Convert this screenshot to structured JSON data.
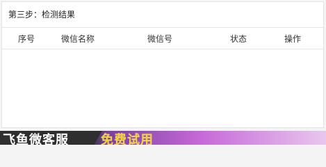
{
  "section": {
    "title": "第三步：检测结果"
  },
  "table": {
    "columns": [
      "序号",
      "微信名称",
      "微信号",
      "状态",
      "操作"
    ],
    "rows": []
  },
  "banner": {
    "brand": "飞鱼微客服",
    "cta": "免费试用"
  },
  "colors": {
    "panel_background": "#ffffff",
    "border": "#e3e3e3",
    "banner_dark": "#2f2f2f",
    "banner_accent": "#f4d43a",
    "banner_purple": "#c86ad9"
  }
}
